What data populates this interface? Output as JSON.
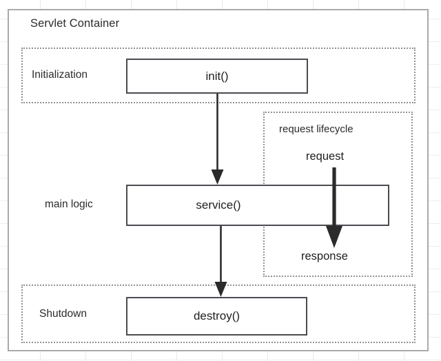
{
  "diagram": {
    "title": "Servlet Container",
    "background": {
      "grid": true,
      "grid_color": "#e9e9ec",
      "page_color": "#ffffff"
    },
    "container": {
      "label": "Servlet Container",
      "border_color": "#a9a9ad"
    },
    "regions": [
      {
        "id": "initialization",
        "label": "Initialization",
        "style": "dotted",
        "border_color": "#8f8f95"
      },
      {
        "id": "main-logic",
        "label": "main logic",
        "style": "none",
        "border_color": "#8f8f95"
      },
      {
        "id": "request-lifecycle",
        "label": "request lifecycle",
        "style": "dotted",
        "border_color": "#8f8f95"
      },
      {
        "id": "shutdown",
        "label": "Shutdown",
        "style": "dotted",
        "border_color": "#8f8f95"
      }
    ],
    "nodes": [
      {
        "id": "init",
        "label": "init()",
        "region": "initialization",
        "border_color": "#4a4a50"
      },
      {
        "id": "service",
        "label": "service()",
        "region": "main-logic",
        "border_color": "#4a4a50"
      },
      {
        "id": "destroy",
        "label": "destroy()",
        "region": "shutdown",
        "border_color": "#4a4a50"
      }
    ],
    "edges": [
      {
        "id": "init-to-service",
        "from": "init",
        "to": "service",
        "label": "",
        "weight": "thin",
        "color": "#2b2b2b"
      },
      {
        "id": "service-to-destroy",
        "from": "service",
        "to": "destroy",
        "label": "",
        "weight": "thin",
        "color": "#2b2b2b"
      },
      {
        "id": "request-to-response",
        "from": "request",
        "to": "response",
        "label": "request",
        "weight": "thick",
        "color": "#2b2b2b"
      }
    ],
    "flow_labels": [
      {
        "id": "request",
        "text": "request"
      },
      {
        "id": "response",
        "text": "response"
      }
    ]
  }
}
